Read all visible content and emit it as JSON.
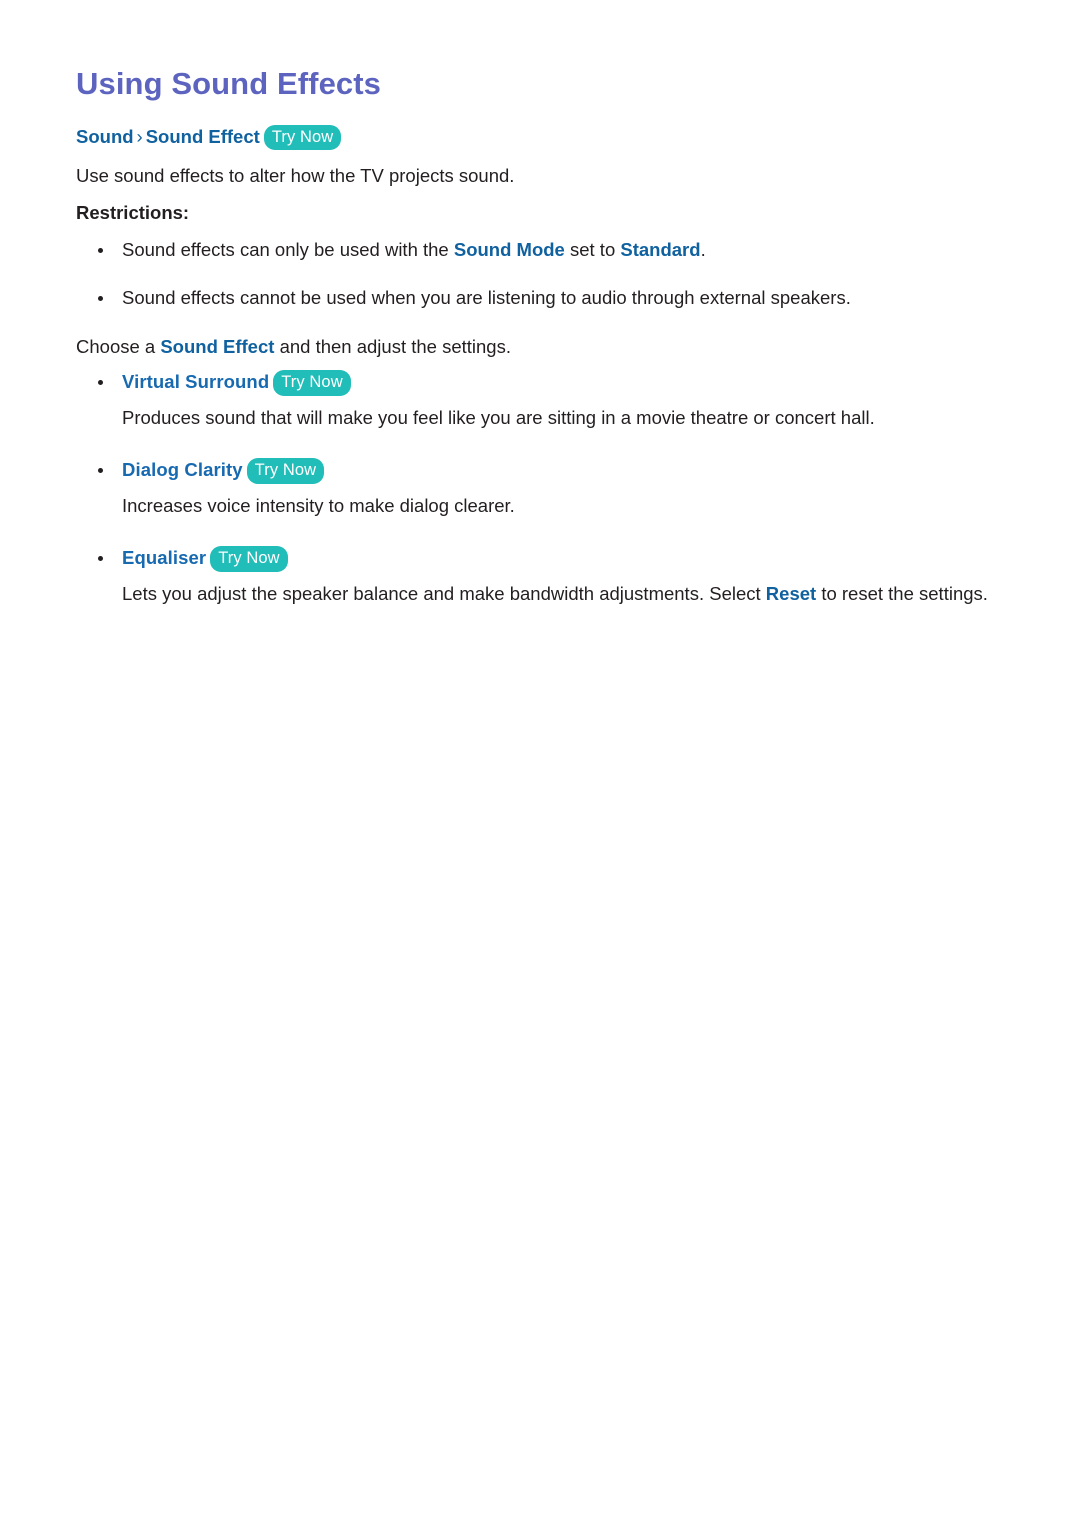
{
  "page": {
    "title": "Using Sound Effects",
    "title_color": "#5c64bf",
    "link_color": "#10619f",
    "option_color": "#1769b0",
    "badge_color": "#21bdb8",
    "text_color": "#231f20",
    "background": "#ffffff"
  },
  "breadcrumb": {
    "root": "Sound",
    "separator": "›",
    "leaf": "Sound Effect",
    "badge": "Try Now"
  },
  "intro": {
    "text": "Use sound effects to alter how the TV projects sound."
  },
  "restrictions": {
    "heading": "Restrictions:",
    "items": [
      {
        "pre": "Sound effects can only be used with the ",
        "hl1": "Sound Mode",
        "mid": " set to ",
        "hl2": "Standard",
        "post": "."
      },
      {
        "pre": "Sound effects cannot be used when you are listening to audio through external speakers.",
        "hl1": "",
        "mid": "",
        "hl2": "",
        "post": ""
      }
    ]
  },
  "choose": {
    "pre": "Choose a ",
    "hl": "Sound Effect",
    "post": " and then adjust the settings."
  },
  "options": [
    {
      "label": "Virtual Surround",
      "badge": "Try Now",
      "description": "Produces sound that will make you feel like you are sitting in a movie theatre or concert hall."
    },
    {
      "label": "Dialog Clarity",
      "badge": "Try Now",
      "description": "Increases voice intensity to make dialog clearer."
    },
    {
      "label": "Equaliser",
      "badge": "Try Now",
      "description_pre": "Lets you adjust the speaker balance and make bandwidth adjustments. Select ",
      "description_hl": "Reset",
      "description_post": " to reset the settings."
    }
  ]
}
